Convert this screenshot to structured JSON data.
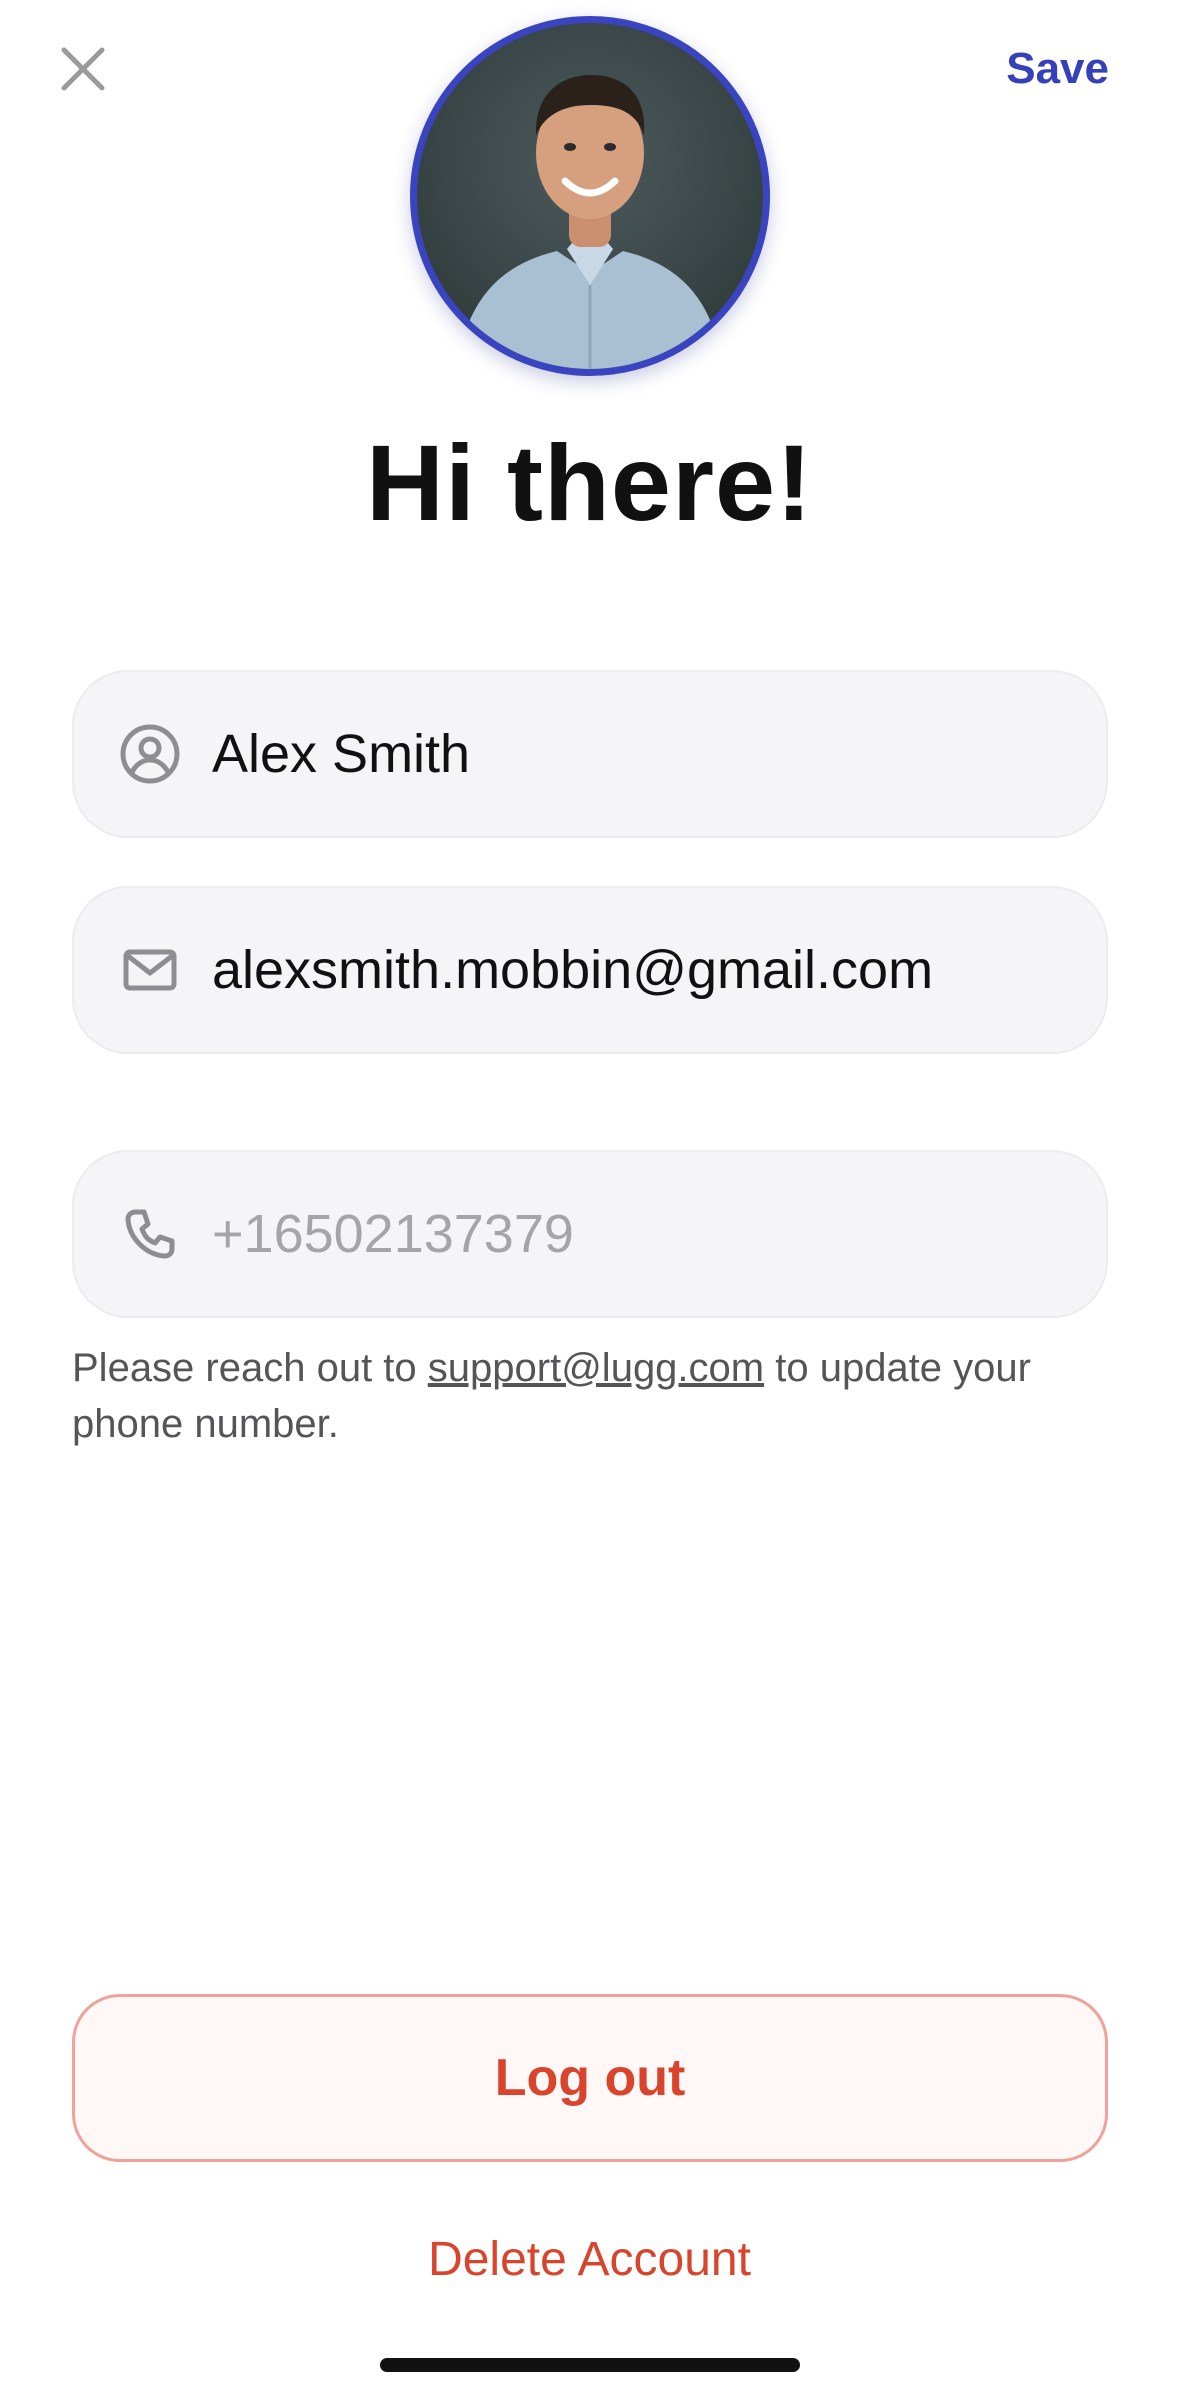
{
  "header": {
    "close_icon": "close-icon",
    "save_label": "Save"
  },
  "profile": {
    "avatar_icon": "profile-photo",
    "greeting": "Hi there!"
  },
  "fields": {
    "name": {
      "icon": "user-circle-icon",
      "value": "Alex Smith"
    },
    "email": {
      "icon": "mail-icon",
      "value": "alexsmith.mobbin@gmail.com"
    },
    "phone": {
      "icon": "phone-icon",
      "value": "+16502137379"
    }
  },
  "helper": {
    "prefix": "Please reach out to ",
    "link": "support@lugg.com",
    "suffix": " to update your phone number."
  },
  "actions": {
    "logout_label": "Log out",
    "delete_label": "Delete Account"
  },
  "colors": {
    "accent": "#3a44c0",
    "danger": "#d9442c",
    "field_bg": "#f5f5f7"
  }
}
